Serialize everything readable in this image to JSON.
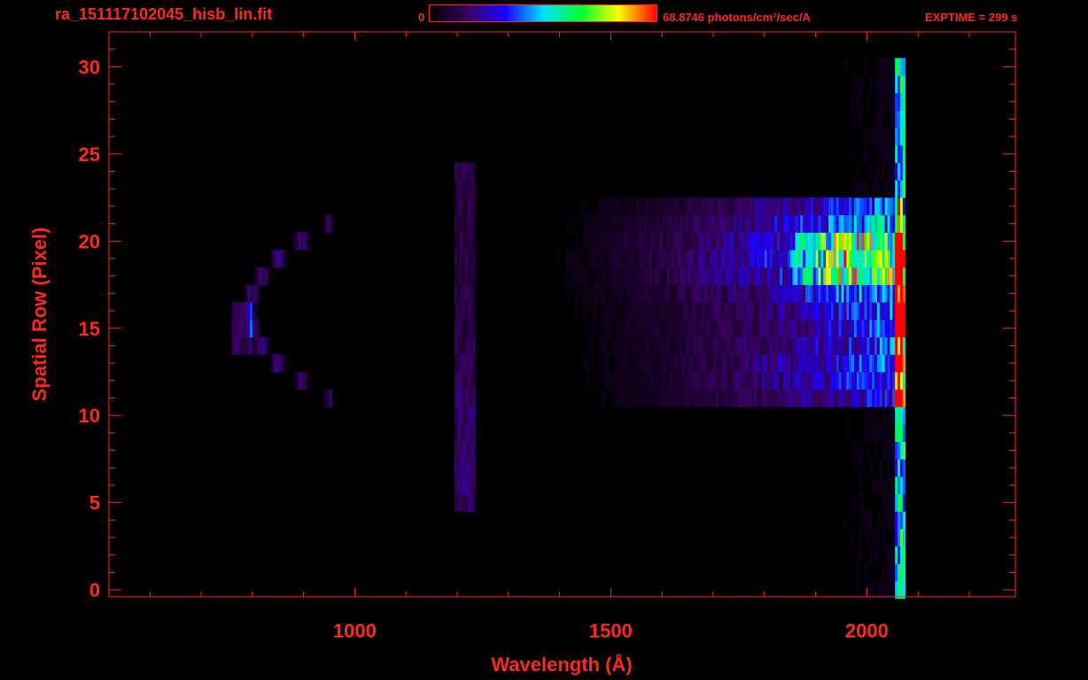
{
  "header": {
    "title": "ra_151117102045_hisb_lin.fit",
    "colorbar_min": "0",
    "colorbar_max": "68.8746 photons/cm²/sec/A",
    "exptime": "EXPTIME = 299 s"
  },
  "colors": {
    "axis": "#ff2a1a",
    "background": "#000000",
    "colorbar_stops": [
      "#000000",
      "#3a0060",
      "#1b00ff",
      "#00e0ff",
      "#00ff30",
      "#ffff00",
      "#ff0000"
    ]
  },
  "chart_data": {
    "type": "heatmap",
    "title": "ra_151117102045_hisb_lin.fit",
    "xlabel": "Wavelength (Å)",
    "ylabel": "Spatial Row (Pixel)",
    "xlim": [
      520,
      2290
    ],
    "ylim": [
      -0.4,
      32
    ],
    "x_ticks": [
      1000,
      1500,
      2000
    ],
    "y_ticks": [
      0,
      5,
      10,
      15,
      20,
      25,
      30
    ],
    "x_minor_step": 100,
    "y_minor_step": 1,
    "colorbar_range": [
      0,
      68.8746
    ],
    "colorbar_unit": "photons/cm²/sec/A",
    "grid": false
  }
}
